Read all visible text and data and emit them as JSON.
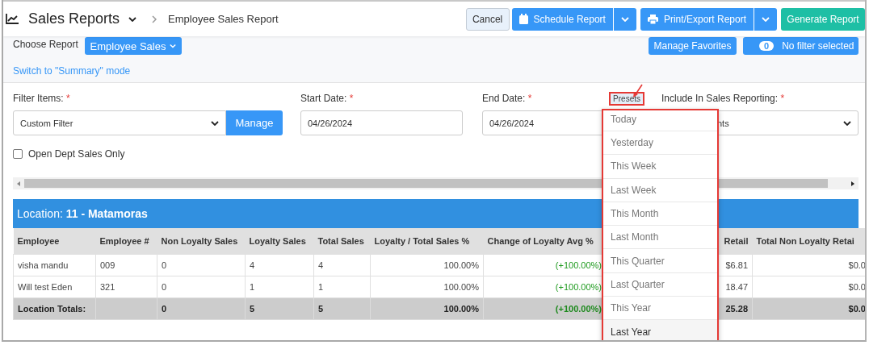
{
  "header": {
    "title": "Sales Reports",
    "breadcrumb": "Employee Sales Report",
    "buttons": [
      {
        "label": "Cancel",
        "kind": "light"
      },
      {
        "label": "Schedule Report",
        "kind": "split"
      },
      {
        "label": "Print/Export Report",
        "kind": "split"
      },
      {
        "label": "Generate Report",
        "kind": "accent"
      }
    ]
  },
  "report": {
    "label": "Choose Report",
    "choice": "Employee Sales",
    "favorites": "Manage Favorites",
    "filter_count": "0",
    "filter_status": "No filter selected",
    "mode_link": "Switch to \"Summary\" mode"
  },
  "filters": [
    {
      "label": "Filter Items:",
      "mark": "*",
      "kind": "select",
      "value": "Custom Filter",
      "button": "Manage"
    },
    {
      "label": "Start Date:",
      "mark": "*",
      "kind": "date",
      "value": "04/26/2024"
    },
    {
      "label": "End Date:",
      "mark": "*",
      "kind": "date",
      "value": "04/26/2024",
      "presets": "Presets"
    },
    {
      "label": "Include In Sales Reporting:",
      "mark": "*",
      "kind": "select",
      "value": "nts"
    }
  ],
  "checkbox": {
    "label": "Open Dept Sales Only",
    "checked": false
  },
  "presets_menu": [
    {
      "label": "Today",
      "selected": false
    },
    {
      "label": "Yesterday",
      "selected": false
    },
    {
      "label": "This Week",
      "selected": false
    },
    {
      "label": "Last Week",
      "selected": false
    },
    {
      "label": "This Month",
      "selected": false
    },
    {
      "label": "Last Month",
      "selected": false
    },
    {
      "label": "This Quarter",
      "selected": false
    },
    {
      "label": "Last Quarter",
      "selected": false
    },
    {
      "label": "This Year",
      "selected": false
    },
    {
      "label": "Last Year",
      "selected": true
    }
  ],
  "location": "Location: **11 - Matamoras**",
  "table": {
    "columns": [
      {
        "label": "Employee",
        "kind": "text"
      },
      {
        "label": "Employee #",
        "kind": "text"
      },
      {
        "label": "Non Loyalty Sales",
        "kind": "text"
      },
      {
        "label": "Loyalty Sales",
        "kind": "text"
      },
      {
        "label": "Total Sales",
        "kind": "text"
      },
      {
        "label": "Loyalty / Total Sales %",
        "kind": "number"
      },
      {
        "label": "Change of Loyalty Avg %",
        "kind": "change"
      },
      {
        "label": "Retail",
        "kind": "clipped"
      },
      {
        "label": "Total Non Loyalty Retai",
        "kind": "number"
      }
    ],
    "rows": [
      {
        "kind": "data",
        "cells": [
          "visha mandu",
          "009",
          "0",
          "4",
          "4",
          "100.00%",
          "(+100.00%)",
          "$6.81",
          "$0.0"
        ]
      },
      {
        "kind": "data",
        "cells": [
          "Will test Eden",
          "321",
          "0",
          "1",
          "1",
          "100.00%",
          "(+100.00%)",
          "18.47",
          "$0.0"
        ]
      },
      {
        "kind": "total",
        "cells": [
          "Location Totals:",
          "",
          "0",
          "5",
          "5",
          "100.00%",
          "(+100.00%)",
          "25.28",
          "$0.0"
        ]
      }
    ]
  }
}
